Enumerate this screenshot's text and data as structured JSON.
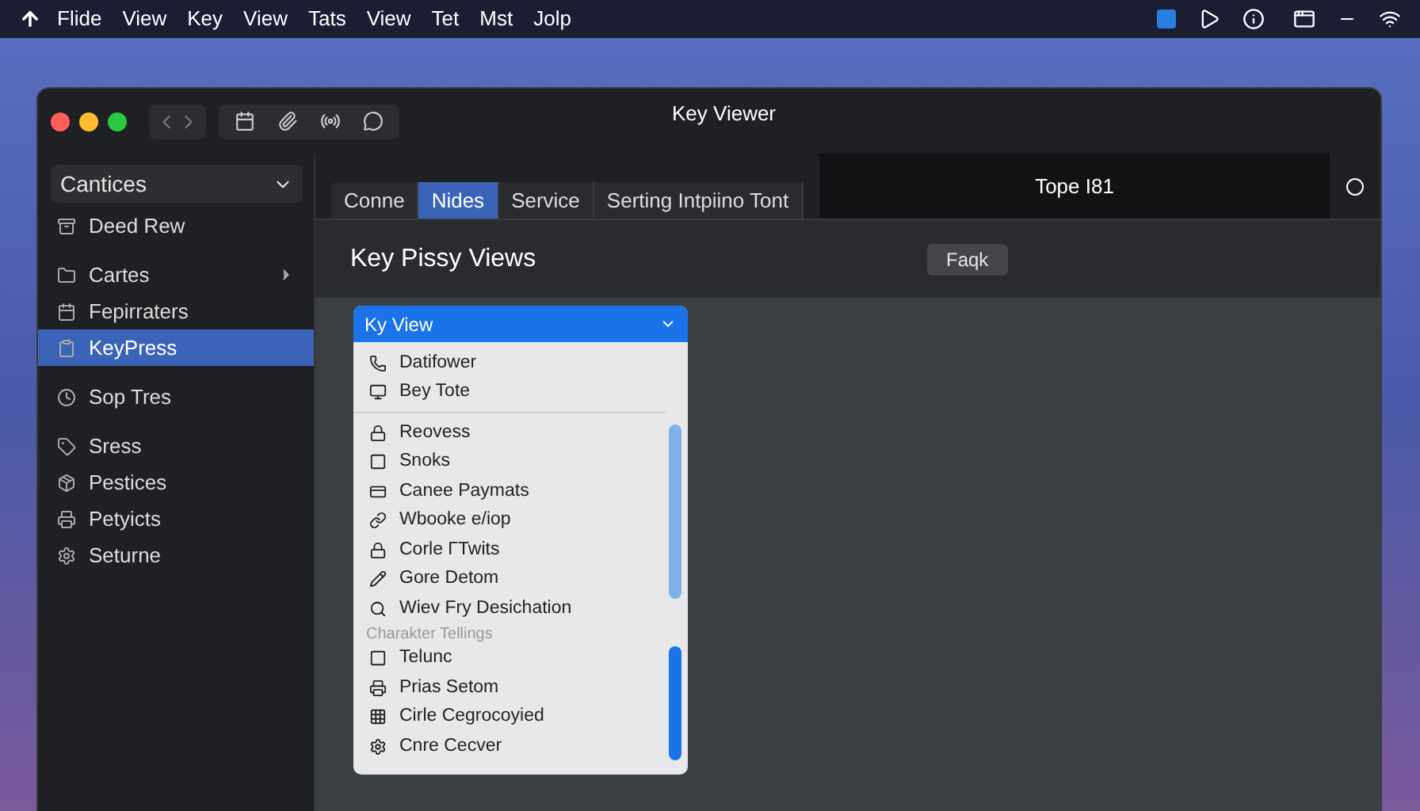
{
  "menu_bar": {
    "items": [
      "Flide",
      "View",
      "Key",
      "View",
      "Tats",
      "View",
      "Tet",
      "Mst",
      "Jolp"
    ]
  },
  "window": {
    "title": "Key Viewer"
  },
  "sidebar": {
    "dropdown": "Cantices",
    "items": [
      {
        "label": "Deed Rew",
        "selected": false,
        "submenu": false
      },
      {
        "label": "Cartes",
        "selected": false,
        "submenu": true
      },
      {
        "label": "Fepirraters",
        "selected": false,
        "submenu": false
      },
      {
        "label": "KeyPress",
        "selected": true,
        "submenu": false
      },
      {
        "label": "Sop Tres",
        "selected": false,
        "submenu": false
      },
      {
        "label": "Sress",
        "selected": false,
        "submenu": false
      },
      {
        "label": "Pestices",
        "selected": false,
        "submenu": false
      },
      {
        "label": "Petyicts",
        "selected": false,
        "submenu": false
      },
      {
        "label": "Seturne",
        "selected": false,
        "submenu": false
      }
    ]
  },
  "tabs": [
    {
      "label": "Conne",
      "selected": false
    },
    {
      "label": "Nides",
      "selected": true
    },
    {
      "label": "Service",
      "selected": false
    },
    {
      "label": "Serting Intpiino Tont",
      "selected": false
    }
  ],
  "right_panel": {
    "title": "Tope I81"
  },
  "header": {
    "title": "Key Pissy Views",
    "button": "Faqk"
  },
  "dropdown": {
    "title": "Ky View",
    "groups": [
      {
        "items": [
          "Datifower",
          "Bey Tote"
        ]
      },
      {
        "items": [
          "Reovess",
          "Snoks",
          "Canee Paymats",
          "Wbooke e/iop",
          "Corle ΓTwits",
          "Gore Detom",
          "Wiev Fry Desichation"
        ]
      },
      {
        "label": "Charakter Tellings",
        "items": [
          "Telunc",
          "Prias Setom",
          "Cirle Cegrocoyied",
          "Cnre Cecver"
        ]
      }
    ]
  }
}
